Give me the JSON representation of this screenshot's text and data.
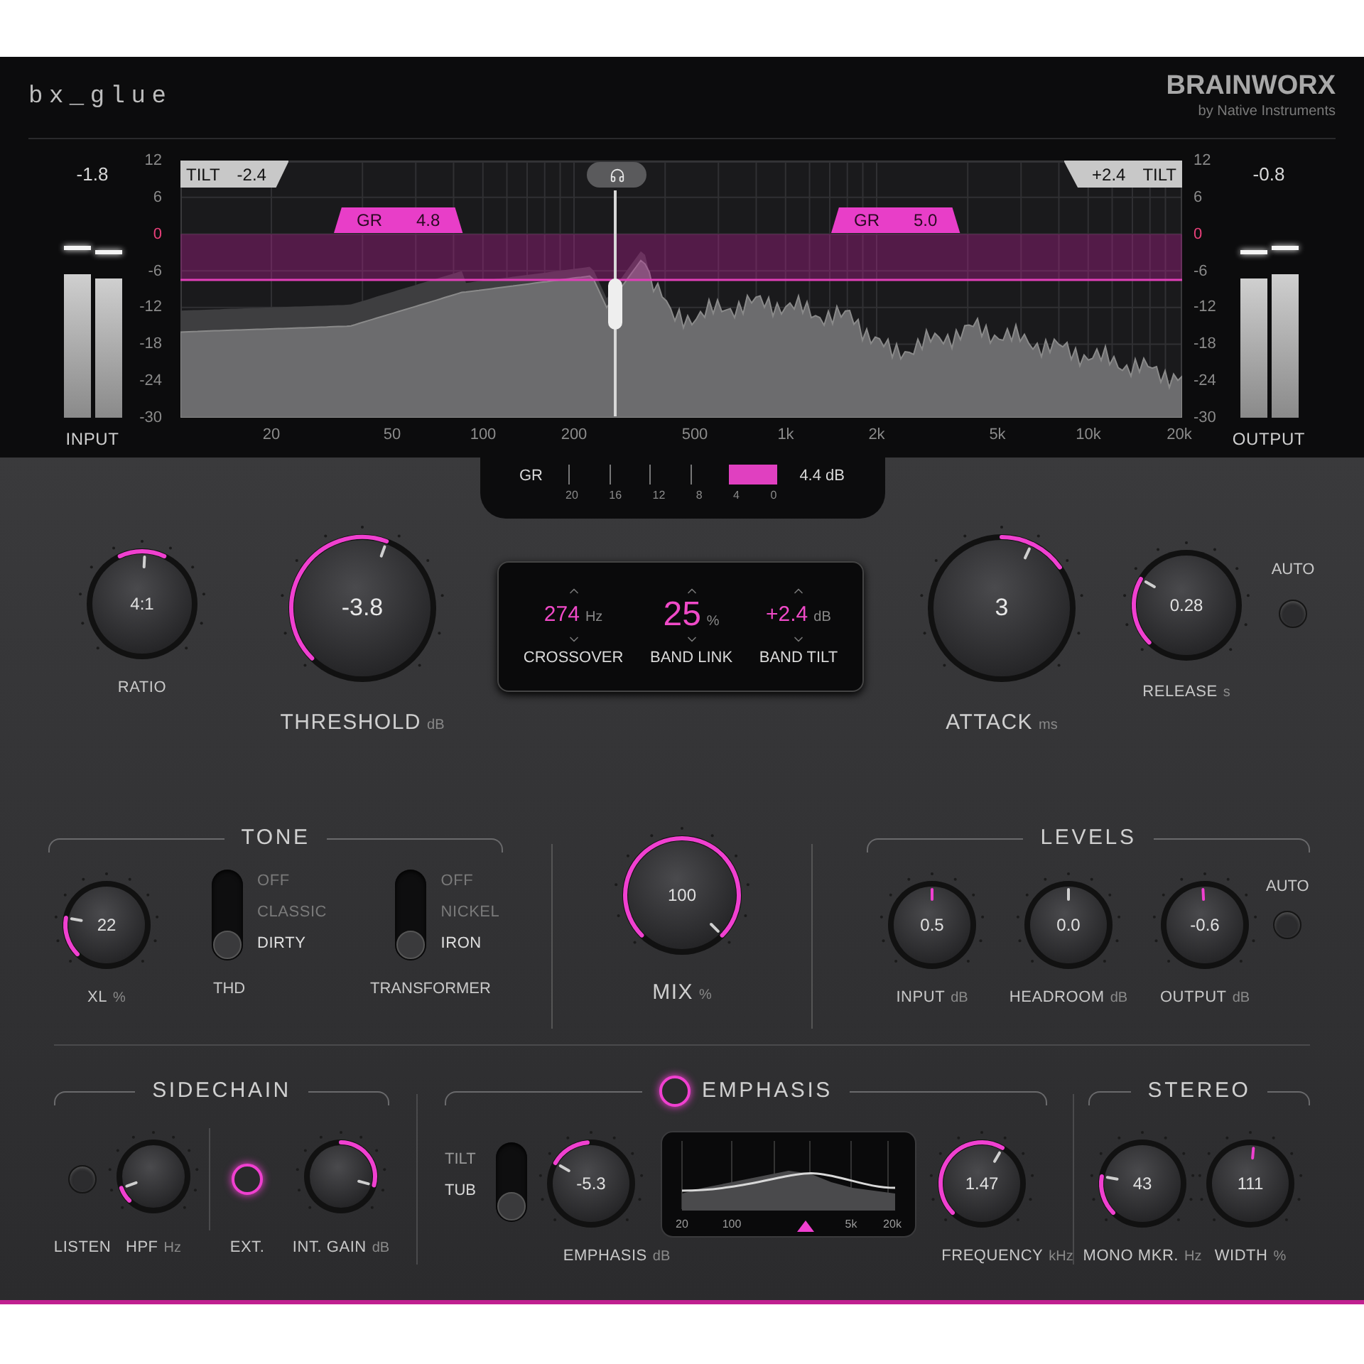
{
  "header": {
    "title": "bx_glue",
    "brand": "BRAINWORX",
    "brand_sub": "by Native Instruments"
  },
  "input_meter": {
    "value": "-1.8",
    "label": "INPUT"
  },
  "output_meter": {
    "value": "-0.8",
    "label": "OUTPUT"
  },
  "spectrum": {
    "y_labels_left": [
      {
        "text": "12",
        "highlighted": false
      },
      {
        "text": "6",
        "highlighted": false
      },
      {
        "text": "0",
        "highlighted": true
      },
      {
        "text": "-6",
        "highlighted": false
      },
      {
        "text": "-12",
        "highlighted": false
      },
      {
        "text": "-18",
        "highlighted": false
      },
      {
        "text": "-24",
        "highlighted": false
      },
      {
        "text": "-30",
        "highlighted": false
      }
    ],
    "y_labels_right": [
      {
        "text": "12",
        "highlighted": false
      },
      {
        "text": "6",
        "highlighted": false
      },
      {
        "text": "0",
        "highlighted": true
      },
      {
        "text": "-6",
        "highlighted": false
      },
      {
        "text": "-12",
        "highlighted": false
      },
      {
        "text": "-18",
        "highlighted": false
      },
      {
        "text": "-24",
        "highlighted": false
      },
      {
        "text": "-30",
        "highlighted": false
      }
    ],
    "x_labels": [
      "20",
      "50",
      "100",
      "200",
      "500",
      "1k",
      "2k",
      "5k",
      "10k",
      "20k"
    ],
    "tilt_low": {
      "label": "TILT",
      "value": "-2.4"
    },
    "tilt_high": {
      "value": "+2.4",
      "label": "TILT"
    },
    "gr_badges": [
      {
        "label": "GR",
        "value": "4.8"
      },
      {
        "label": "GR",
        "value": "5.0"
      }
    ]
  },
  "gr_meter": {
    "label": "GR",
    "ticks": [
      "20",
      "16",
      "12",
      "8",
      "4",
      "0"
    ],
    "reading": "4.4 dB"
  },
  "dynamics": {
    "ratio": {
      "value": "4:1",
      "label": "RATIO"
    },
    "threshold": {
      "value": "-3.8",
      "label": "THRESHOLD",
      "unit": "dB"
    },
    "display": [
      {
        "value": "274",
        "unit": "Hz",
        "label": "CROSSOVER"
      },
      {
        "value": "25",
        "unit": "%",
        "label": "BAND LINK"
      },
      {
        "value": "+2.4",
        "unit": "dB",
        "label": "BAND TILT"
      }
    ],
    "attack": {
      "value": "3",
      "label": "ATTACK",
      "unit": "ms"
    },
    "release": {
      "value": "0.28",
      "label": "RELEASE",
      "unit": "s"
    },
    "auto": {
      "label": "AUTO",
      "on": false
    }
  },
  "tone": {
    "title": "TONE",
    "xl": {
      "value": "22",
      "label": "XL",
      "unit": "%"
    },
    "thd": {
      "label": "THD",
      "options": [
        {
          "text": "OFF",
          "selected": false
        },
        {
          "text": "CLASSIC",
          "selected": false
        },
        {
          "text": "DIRTY",
          "selected": true
        }
      ]
    },
    "transformer": {
      "label": "TRANSFORMER",
      "options": [
        {
          "text": "OFF",
          "selected": false
        },
        {
          "text": "NICKEL",
          "selected": false
        },
        {
          "text": "IRON",
          "selected": true
        }
      ]
    }
  },
  "mix": {
    "value": "100",
    "label": "MIX",
    "unit": "%"
  },
  "levels": {
    "title": "LEVELS",
    "knobs": [
      {
        "value": "0.5",
        "label": "INPUT",
        "unit": "dB"
      },
      {
        "value": "0.0",
        "label": "HEADROOM",
        "unit": "dB"
      },
      {
        "value": "-0.6",
        "label": "OUTPUT",
        "unit": "dB"
      }
    ],
    "auto": {
      "label": "AUTO",
      "on": false
    }
  },
  "sidechain": {
    "title": "SIDECHAIN",
    "listen": {
      "label": "LISTEN",
      "on": false
    },
    "hpf": {
      "label": "HPF",
      "unit": "Hz"
    },
    "ext": {
      "label": "EXT.",
      "on": true
    },
    "int_gain": {
      "label": "INT. GAIN",
      "unit": "dB"
    }
  },
  "emphasis": {
    "title": "EMPHASIS",
    "on": true,
    "mode": {
      "options": [
        {
          "text": "TILT",
          "selected": false
        },
        {
          "text": "TUB",
          "selected": true
        }
      ]
    },
    "amount": {
      "value": "-5.3",
      "label": "EMPHASIS",
      "unit": "dB"
    },
    "display_labels": [
      "20",
      "100",
      "5k",
      "20k"
    ],
    "frequency": {
      "value": "1.47",
      "label": "FREQUENCY",
      "unit": "kHz"
    }
  },
  "stereo": {
    "title": "STEREO",
    "knobs": [
      {
        "value": "43",
        "label": "MONO MKR.",
        "unit": "Hz"
      },
      {
        "value": "111",
        "label": "WIDTH",
        "unit": "%"
      }
    ]
  }
}
